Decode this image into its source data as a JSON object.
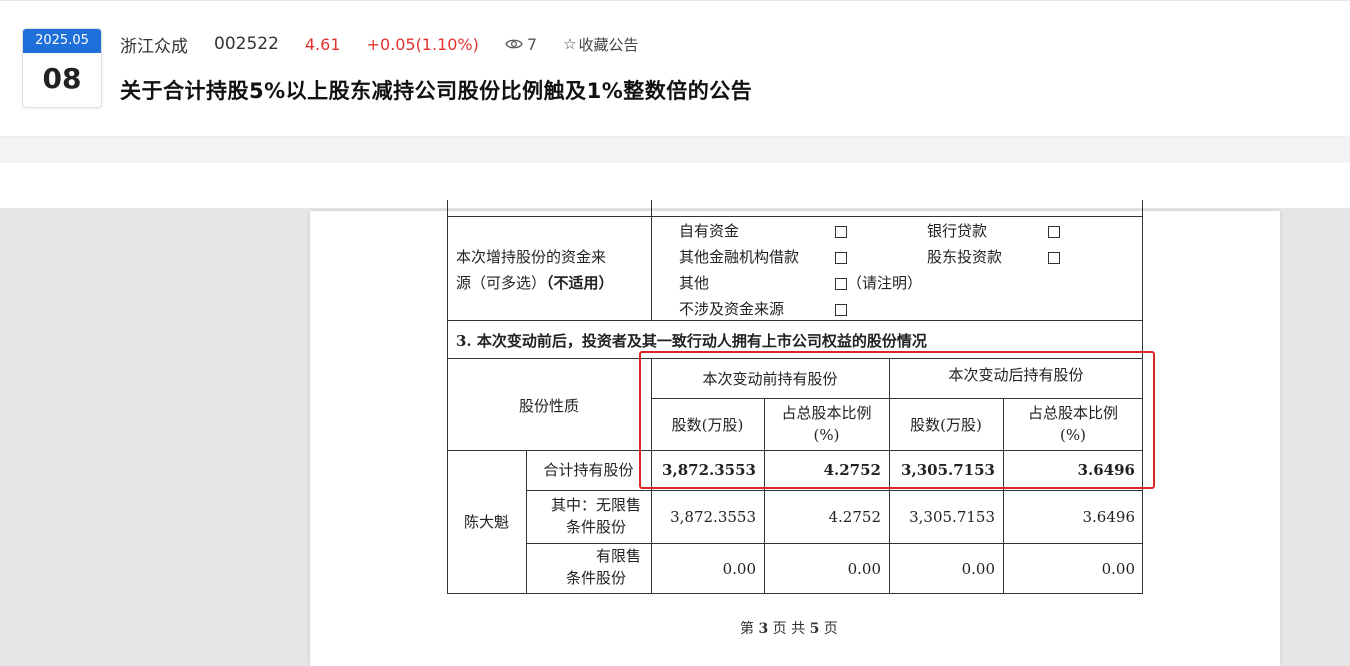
{
  "header": {
    "date_ym": "2025.05",
    "date_day": "08",
    "stock_name": "浙江众成",
    "stock_code": "002522",
    "price": "4.61",
    "change": "+0.05(1.10%)",
    "views": "7",
    "favorite_label": "收藏公告",
    "title": "关于合计持股5%以上股东减持公司股份比例触及1%整数倍的公告"
  },
  "colors": {
    "accent_blue": "#1e6fd9",
    "price_red": "#e0332f",
    "highlight_red": "#d9262a"
  },
  "doc": {
    "funding": {
      "label_line1": "本次增持股份的资金来",
      "label_line2": "源（可多选）",
      "label_bold": "（不适用）",
      "opt_own_funds": "自有资金",
      "opt_bank_loan": "银行贷款",
      "opt_other_fin": "其他金融机构借款",
      "opt_shareholder_loan": "股东投资款",
      "opt_other": "其他",
      "opt_other_note": "（请注明）",
      "opt_none": "不涉及资金来源"
    },
    "section3_title": "3. 本次变动前后，投资者及其一致行动人拥有上市公司权益的股份情况",
    "table": {
      "col_nature": "股份性质",
      "before_header": "本次变动前持有股份",
      "after_header": "本次变动后持有股份",
      "shares_header": "股数(万股)",
      "ratio_header_line1": "占总股本比例",
      "ratio_header_line2": "(%)",
      "holder": "陈大魁",
      "rows": [
        {
          "label_line1": "合计持有股份",
          "label_line2": "",
          "before_shares": "3,872.3553",
          "before_ratio": "4.2752",
          "after_shares": "3,305.7153",
          "after_ratio": "3.6496"
        },
        {
          "label_line1": "其中：无限售",
          "label_line2": "条件股份",
          "before_shares": "3,872.3553",
          "before_ratio": "4.2752",
          "after_shares": "3,305.7153",
          "after_ratio": "3.6496"
        },
        {
          "label_line1": "有限售",
          "label_line2": "条件股份",
          "before_shares": "0.00",
          "before_ratio": "0.00",
          "after_shares": "0.00",
          "after_ratio": "0.00"
        }
      ]
    },
    "pager": {
      "prefix": "第",
      "current": "3",
      "middle": "页 共",
      "total": "5",
      "suffix": "页"
    }
  }
}
